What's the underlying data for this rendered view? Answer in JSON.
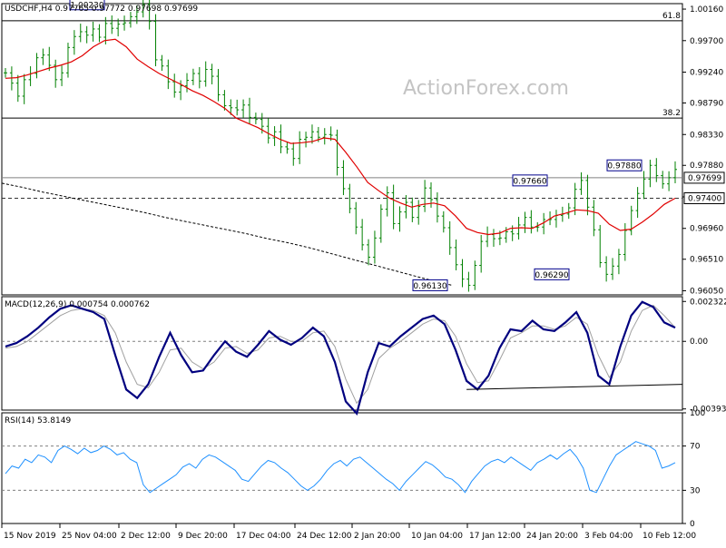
{
  "header": {
    "price_symbol": "USDCHF,H4",
    "price_ohlc": "0.97765 0.97772 0.97698 0.97699",
    "macd_title": "MACD(12,26,9) 0.000754 0.000762",
    "rsi_title": "RSI(14) 53.8149"
  },
  "watermark": "ActionForex.com",
  "fib_labels": {
    "upper": "61.8",
    "lower": "38.2"
  },
  "colors": {
    "price_bar": "#008000",
    "moving_average": "#e00000",
    "macd_line": "#00007f",
    "signal_line": "#a0a0a0",
    "rsi_line": "#1e90ff",
    "tag_border": "#00008b",
    "grid_dash": "#808080"
  },
  "chart_data": [
    {
      "type": "line",
      "panel": "price",
      "title": "USDCHF,H4",
      "ylim": [
        0.9599,
        1.0024
      ],
      "y_ticks": [
        1.0016,
        0.997,
        0.9924,
        0.9879,
        0.9833,
        0.9788,
        0.9742,
        0.9696,
        0.9651,
        0.9605
      ],
      "y_tick_labels": [
        "1.00160",
        "0.99700",
        "0.99240",
        "0.98790",
        "0.98330",
        "0.97880",
        "0.97420",
        "0.96960",
        "0.96510",
        "0.96050"
      ],
      "x_tick_labels": [
        "15 Nov 2019",
        "25 Nov 04:00",
        "2 Dec 12:00",
        "9 Dec 20:00",
        "17 Dec 04:00",
        "24 Dec 12:00",
        "2 Jan 20:00",
        "10 Jan 04:00",
        "17 Jan 12:00",
        "24 Jan 20:00",
        "3 Feb 04:00",
        "10 Feb 12:00"
      ],
      "current_price": 0.97699,
      "current_price_label": "0.97699",
      "horizontal_levels": [
        {
          "label": "0.97400",
          "value": 0.974,
          "style": "dashed"
        },
        {
          "label": "61.8",
          "value": 0.9999,
          "style": "solid"
        },
        {
          "label": "38.2",
          "value": 0.9857,
          "style": "solid"
        }
      ],
      "annotations": [
        {
          "label": "1.00230",
          "value": 1.0023
        },
        {
          "label": "0.97660",
          "value": 0.9766
        },
        {
          "label": "0.97880",
          "value": 0.9788
        },
        {
          "label": "0.96130",
          "value": 0.9613
        },
        {
          "label": "0.96290",
          "value": 0.9629
        }
      ],
      "series": [
        {
          "style": "ohlc",
          "values": [
            0.9923,
            0.9908,
            0.9889,
            0.9913,
            0.9922,
            0.9945,
            0.9949,
            0.9934,
            0.9913,
            0.9923,
            0.996,
            0.9976,
            0.9983,
            0.9978,
            0.9987,
            0.9975,
            0.9995,
            0.9988,
            0.9994,
            0.9996,
            1.0005,
            1.0012,
            1.0023,
            0.9998,
            0.9942,
            0.9933,
            0.991,
            0.9895,
            0.9904,
            0.9912,
            0.9922,
            0.9911,
            0.9928,
            0.9918,
            0.9891,
            0.9875,
            0.9872,
            0.9869,
            0.9876,
            0.9858,
            0.9855,
            0.9845,
            0.9828,
            0.9837,
            0.9815,
            0.9812,
            0.9798,
            0.9826,
            0.9829,
            0.9837,
            0.9829,
            0.9833,
            0.9832,
            0.9785,
            0.9754,
            0.9725,
            0.9698,
            0.9672,
            0.9654,
            0.9682,
            0.9724,
            0.9748,
            0.9703,
            0.972,
            0.9734,
            0.9712,
            0.9728,
            0.9755,
            0.9738,
            0.9714,
            0.9697,
            0.9668,
            0.9643,
            0.9622,
            0.9613,
            0.9642,
            0.9677,
            0.9687,
            0.9681,
            0.9682,
            0.9691,
            0.9688,
            0.9701,
            0.9712,
            0.9698,
            0.9698,
            0.9709,
            0.9709,
            0.9715,
            0.9717,
            0.9726,
            0.9753,
            0.9766,
            0.9727,
            0.9694,
            0.9646,
            0.9629,
            0.9641,
            0.9658,
            0.9693,
            0.9722,
            0.9747,
            0.9768,
            0.9788,
            0.9773,
            0.9761,
            0.977,
            0.9782
          ]
        },
        {
          "style": "line",
          "name": "",
          "values": [
            0.9915,
            0.9916,
            0.992,
            0.9925,
            0.993,
            0.9934,
            0.9939,
            0.9948,
            0.9961,
            0.997,
            0.9972,
            0.9961,
            0.9943,
            0.9932,
            0.9922,
            0.9914,
            0.9906,
            0.9897,
            0.989,
            0.9881,
            0.9871,
            0.9857,
            0.985,
            0.9843,
            0.9834,
            0.9826,
            0.982,
            0.9821,
            0.9823,
            0.9828,
            0.9826,
            0.9807,
            0.9786,
            0.9763,
            0.9751,
            0.974,
            0.9733,
            0.9727,
            0.9731,
            0.9733,
            0.9729,
            0.9714,
            0.9696,
            0.969,
            0.9687,
            0.9689,
            0.9696,
            0.9697,
            0.9696,
            0.9704,
            0.9714,
            0.9718,
            0.9723,
            0.9722,
            0.9718,
            0.9702,
            0.9693,
            0.9695,
            0.9705,
            0.9717,
            0.9731,
            0.974
          ]
        },
        {
          "style": "dashed-line",
          "name": "",
          "values": [
            0.9762,
            0.9756,
            0.9749,
            0.9743,
            0.9737,
            0.9731,
            0.9725,
            0.9719,
            0.9712,
            0.9706,
            0.97,
            0.9694,
            0.9688,
            0.9681,
            0.9675,
            0.9668,
            0.966,
            0.9652,
            0.9644,
            0.9636,
            0.9628,
            0.962,
            0.9613
          ]
        }
      ]
    },
    {
      "type": "line",
      "panel": "macd",
      "title": "MACD(12,26,9) 0.000754 0.000762",
      "ylim": [
        -0.004,
        0.0026
      ],
      "y_tick_labels": [
        "0.002322",
        "0.00",
        "-0.003932"
      ],
      "y_ticks": [
        0.002322,
        0,
        -0.003932
      ],
      "series": [
        {
          "name": "MACD",
          "values": [
            -0.0003,
            -0.0001,
            0.0003,
            0.0008,
            0.0014,
            0.0019,
            0.0021,
            0.0019,
            0.0017,
            0.0013,
            -0.0008,
            -0.0028,
            -0.0033,
            -0.0025,
            -0.0009,
            0.0005,
            -0.0008,
            -0.0018,
            -0.0017,
            -0.0008,
            0.0,
            -0.0006,
            -0.0009,
            -0.0002,
            0.0006,
            0.0001,
            -0.0002,
            0.0002,
            0.0008,
            0.0003,
            -0.0012,
            -0.0035,
            -0.0042,
            -0.0018,
            -0.0001,
            -0.0003,
            0.0003,
            0.0008,
            0.0013,
            0.0015,
            0.001,
            -0.0005,
            -0.0023,
            -0.0028,
            -0.002,
            -0.0004,
            0.0007,
            0.0006,
            0.0012,
            0.0007,
            0.0006,
            0.0011,
            0.0017,
            0.0005,
            -0.002,
            -0.0025,
            -0.0003,
            0.0015,
            0.0023,
            0.002,
            0.0011,
            0.0008
          ]
        },
        {
          "name": "Signal",
          "values": [
            -0.0004,
            -0.0003,
            0.0,
            0.0005,
            0.001,
            0.0015,
            0.0018,
            0.0019,
            0.0018,
            0.0015,
            0.0005,
            -0.0012,
            -0.0025,
            -0.0027,
            -0.0018,
            -0.0005,
            -0.0004,
            -0.0012,
            -0.0016,
            -0.0012,
            -0.0004,
            -0.0003,
            -0.0007,
            -0.0005,
            0.0002,
            0.0003,
            0.0,
            0.0,
            0.0005,
            0.0006,
            -0.0003,
            -0.0022,
            -0.0036,
            -0.0028,
            -0.001,
            -0.0004,
            0.0,
            0.0005,
            0.001,
            0.0013,
            0.0012,
            0.0003,
            -0.0013,
            -0.0024,
            -0.0023,
            -0.0011,
            0.0002,
            0.0005,
            0.0009,
            0.0009,
            0.0007,
            0.0009,
            0.0014,
            0.001,
            -0.0008,
            -0.0021,
            -0.0012,
            0.0006,
            0.0018,
            0.0021,
            0.0015,
            0.0008
          ]
        }
      ],
      "trendline": {
        "from": -0.0028,
        "to": -0.0025
      }
    },
    {
      "type": "line",
      "panel": "rsi",
      "title": "RSI(14) 53.8149",
      "ylim": [
        0,
        100
      ],
      "y_ticks": [
        100,
        70,
        30,
        0
      ],
      "y_tick_labels": [
        "100",
        "70",
        "30",
        "0"
      ],
      "series": [
        {
          "name": "RSI",
          "values": [
            45,
            52,
            50,
            58,
            55,
            62,
            60,
            55,
            66,
            70,
            67,
            63,
            68,
            64,
            66,
            70,
            67,
            62,
            64,
            58,
            55,
            35,
            28,
            32,
            36,
            40,
            44,
            51,
            54,
            50,
            58,
            62,
            60,
            56,
            52,
            48,
            40,
            38,
            45,
            52,
            57,
            55,
            50,
            46,
            40,
            34,
            30,
            34,
            40,
            48,
            54,
            57,
            52,
            58,
            60,
            55,
            50,
            45,
            40,
            36,
            30,
            38,
            44,
            50,
            56,
            53,
            48,
            42,
            40,
            35,
            28,
            38,
            45,
            52,
            56,
            58,
            55,
            60,
            56,
            52,
            48,
            55,
            58,
            62,
            58,
            63,
            67,
            60,
            50,
            30,
            28,
            40,
            52,
            62,
            66,
            70,
            74,
            72,
            70,
            66,
            50,
            52,
            55
          ]
        }
      ]
    }
  ]
}
